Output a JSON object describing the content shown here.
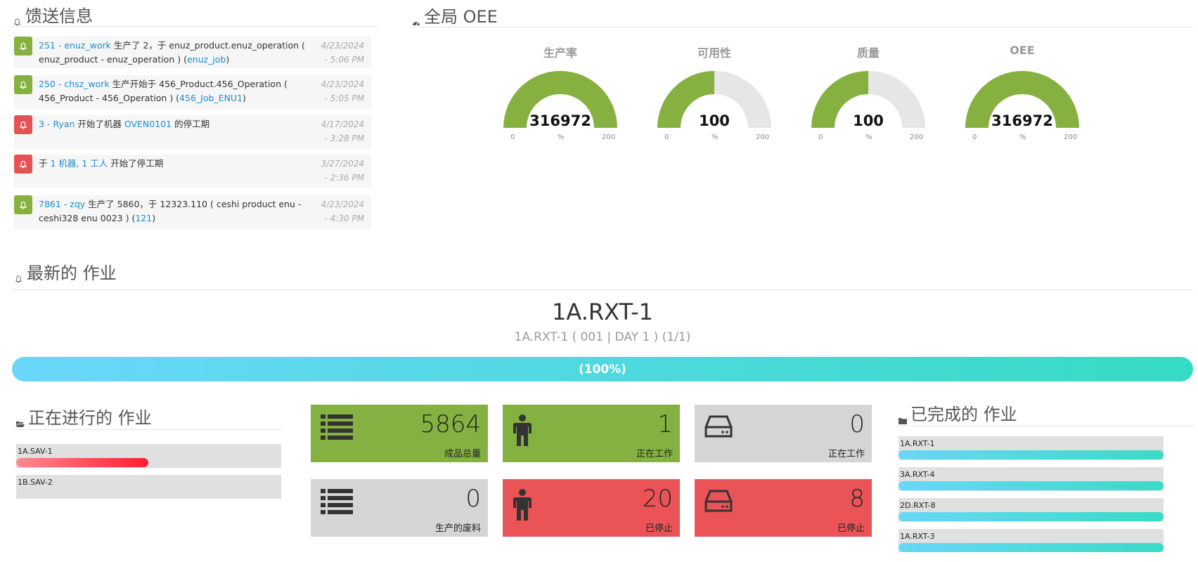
{
  "feed": {
    "title": "馈送信息",
    "items": [
      {
        "type": "green",
        "link1": "251 - enuz_work",
        "text1": " 生产了 2，于 enuz_product.enuz_operation ( enuz_product - enuz_operation ) (",
        "link2": "enuz_job",
        "text2": ")",
        "date": "4/23/2024",
        "time": "- 5:06 PM"
      },
      {
        "type": "green",
        "link1": "250 - chsz_work",
        "text1": " 生产开始于 456_Product.456_Operation ( 456_Product - 456_Operation ) (",
        "link2": "456_Job_ENU1",
        "text2": ")",
        "date": "4/23/2024",
        "time": "- 5:05 PM"
      },
      {
        "type": "red",
        "link1": "3 - Ryan",
        "text1": " 开始了机器 ",
        "link2": "OVEN0101",
        "text2": " 的停工期",
        "date": "4/17/2024",
        "time": "- 3:28 PM"
      },
      {
        "type": "red",
        "prefix": "于 ",
        "link1": "1 机器, 1 工人",
        "text1": " 开始了停工期",
        "link2": "",
        "text2": "",
        "date": "3/27/2024",
        "time": "- 2:36 PM"
      },
      {
        "type": "green",
        "link1": "7861 - zqy",
        "text1": " 生产了 5860，于 12323.110 ( ceshi product enu - ceshi328 enu 0023 ) (",
        "link2": "121",
        "text2": ")",
        "date": "4/23/2024",
        "time": "- 4:30 PM"
      }
    ]
  },
  "oee": {
    "title": "全局 OEE",
    "gauges": [
      {
        "title": "生产率",
        "value_text": "316972",
        "value": 316972,
        "min": "0",
        "max": "200",
        "unit": "%"
      },
      {
        "title": "可用性",
        "value_text": "100",
        "value": 100,
        "min": "0",
        "max": "200",
        "unit": "%"
      },
      {
        "title": "质量",
        "value_text": "100",
        "value": 100,
        "min": "0",
        "max": "200",
        "unit": "%"
      },
      {
        "title": "OEE",
        "value_text": "316972",
        "value": 316972,
        "min": "0",
        "max": "200",
        "unit": "%"
      }
    ],
    "colors": {
      "fill": "#86b140",
      "track": "#e6e6e6"
    }
  },
  "latest": {
    "title": "最新的 作业",
    "job_name": "1A.RXT-1",
    "job_detail": "1A.RXT-1 ( 001 | DAY 1 ) (1/1)",
    "progress_text": "(100%)",
    "progress": 1.0
  },
  "in_progress": {
    "title": "正在进行的 作业",
    "items": [
      {
        "label": "1A.SAV-1",
        "progress": 0.5
      },
      {
        "label": "1B.SAV-2",
        "progress": 0
      }
    ]
  },
  "tiles": [
    {
      "value": "5864",
      "caption": "成品总量",
      "color": "green",
      "icon": "list-icon"
    },
    {
      "value": "1",
      "caption": "正在工作",
      "color": "green",
      "icon": "person-icon"
    },
    {
      "value": "0",
      "caption": "正在工作",
      "color": "grey",
      "icon": "drive-icon"
    },
    {
      "value": "0",
      "caption": "生产的废料",
      "color": "grey",
      "icon": "list-icon"
    },
    {
      "value": "20",
      "caption": "已停止",
      "color": "red",
      "icon": "person-icon"
    },
    {
      "value": "8",
      "caption": "已停止",
      "color": "red",
      "icon": "drive-icon"
    }
  ],
  "done": {
    "title": "已完成的 作业",
    "items": [
      {
        "label": "1A.RXT-1",
        "progress": 1.0
      },
      {
        "label": "3A.RXT-4",
        "progress": 1.0
      },
      {
        "label": "2D.RXT-8",
        "progress": 1.0
      },
      {
        "label": "1A.RXT-3",
        "progress": 1.0
      }
    ]
  }
}
